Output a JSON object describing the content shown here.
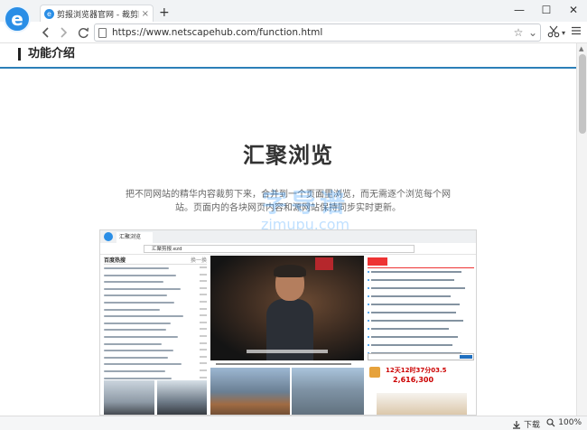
{
  "browser": {
    "tab": {
      "title": "剪报浏览器官网 - 裁剪网",
      "close": "×"
    },
    "new_tab": "+",
    "window": {
      "minimize": "—",
      "maximize": "☐",
      "close": "✕"
    },
    "address": {
      "url": "https://www.netscapehub.com/function.html"
    },
    "status": {
      "download_label": "下载",
      "zoom": "100%"
    }
  },
  "page": {
    "section_title": "功能介绍",
    "feature_title": "汇聚浏览",
    "description": "把不同网站的精华内容裁剪下来，合并到一个页面里浏览，而无需逐个浏览每个网站。页面内的各块网页内容和源网站保持同步实时更新。",
    "watermark": {
      "cn": "字导谱",
      "en": "zimupu.com"
    }
  },
  "mockup": {
    "tab_title": "汇聚浏览",
    "url": "汇聚剪报.ezd",
    "left_head": "百度热搜",
    "left_more": "换一换",
    "countdown": "12天12时37分03.5",
    "counter": "2,616,300"
  },
  "colors": {
    "accent": "#2c7fb8",
    "brand": "#2a8ee6"
  }
}
